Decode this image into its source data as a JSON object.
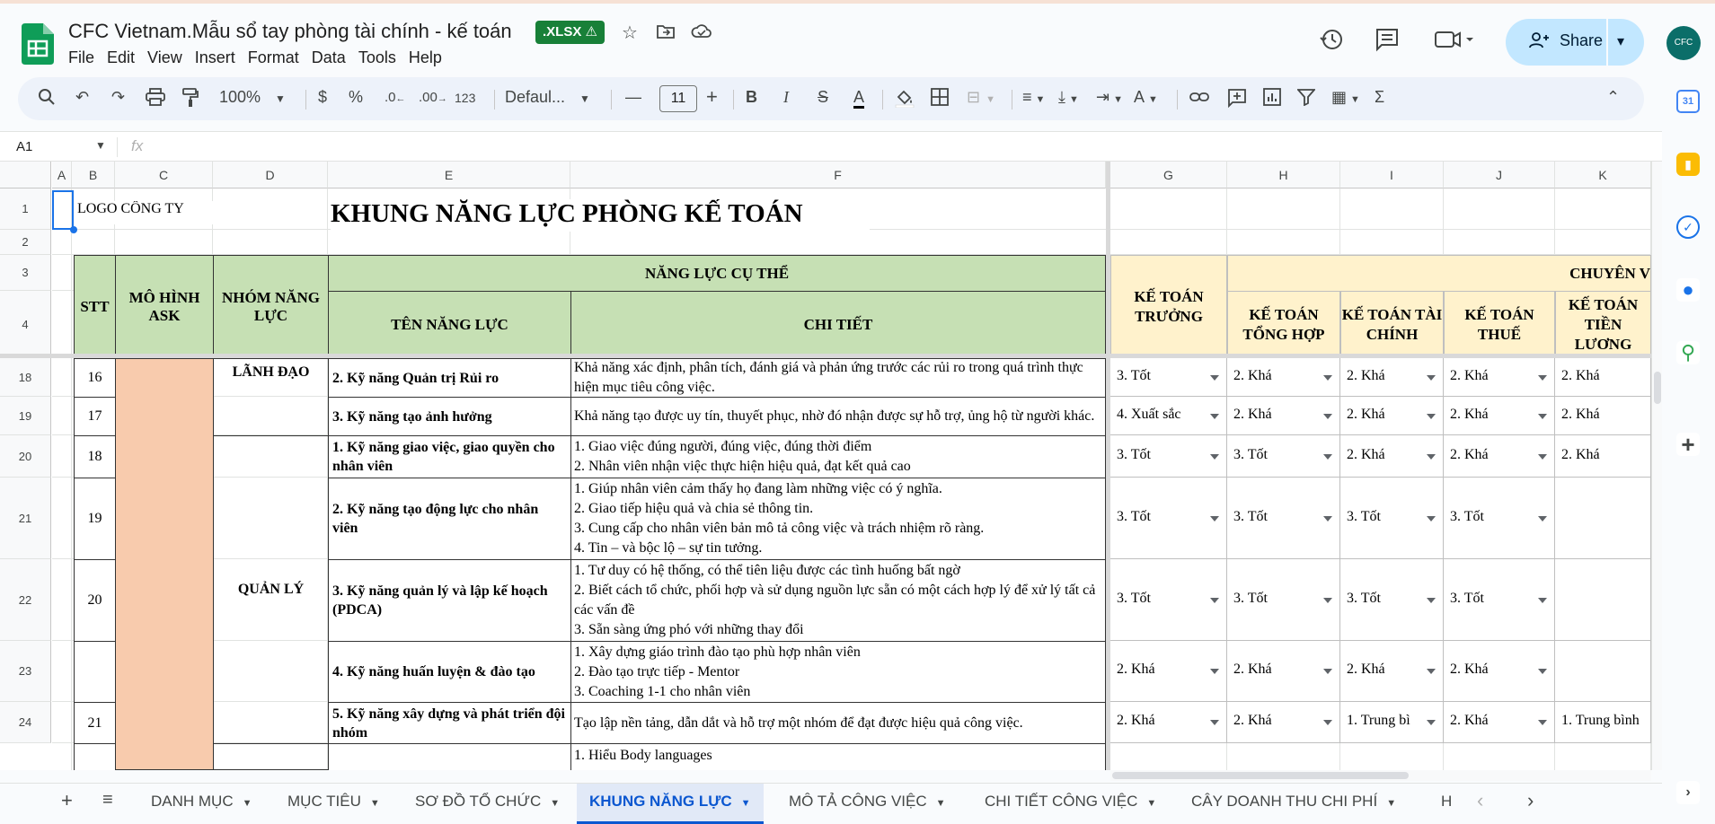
{
  "doc": {
    "title": "CFC Vietnam.Mẫu sổ tay phòng tài chính - kế toán",
    "badge": ".XLSX ⚠"
  },
  "menu": [
    "File",
    "Edit",
    "View",
    "Insert",
    "Format",
    "Data",
    "Tools",
    "Help"
  ],
  "share_label": "Share",
  "toolbar": {
    "zoom": "100%",
    "currency": "$",
    "percent": "%",
    "dec_decrease": ".0",
    "dec_increase": ".00",
    "number_format": "123",
    "font": "Defaul...",
    "font_size": "11",
    "bold": "B",
    "italic": "I",
    "strike": "S",
    "text_color": "A"
  },
  "formula_bar": {
    "cell_ref": "A1",
    "fx": "fx"
  },
  "columns": [
    "A",
    "B",
    "C",
    "D",
    "E",
    "F",
    "G",
    "H",
    "I",
    "J",
    "K"
  ],
  "rows": [
    "1",
    "2",
    "3",
    "4",
    "18",
    "19",
    "20",
    "21",
    "22",
    "23",
    "24"
  ],
  "sheet": {
    "logo": "LOGO CÔNG TY",
    "title": "KHUNG NĂNG LỰC PHÒNG KẾ TOÁN",
    "headers": {
      "stt": "STT",
      "ask": "MÔ HÌNH ASK",
      "group": "NHÓM NĂNG LỰC",
      "specific": "NĂNG LỰC CỤ THỂ",
      "name": "TÊN NĂNG LỰC",
      "detail": "CHI TIẾT",
      "chief": "KẾ TOÁN TRƯỞNG",
      "specialist": "CHUYÊN V",
      "general": "KẾ TOÁN TỔNG HỢP",
      "finance": "KẾ TOÁN TÀI CHÍNH",
      "tax": "KẾ TOÁN THUẾ",
      "salary": "KẾ TOÁN TIỀN LƯƠNG"
    },
    "groups": {
      "leadership": "LÃNH ĐẠO",
      "management": "QUẢN LÝ"
    },
    "rows": [
      {
        "stt": "16",
        "name": "2. Kỹ năng Quản trị Rủi ro",
        "detail": "Khả năng xác định, phân tích, đánh giá và phản ứng trước các rủi ro trong quá trình thực hiện mục tiêu công việc.",
        "g": "3. Tốt",
        "h": "2. Khá",
        "i": "2. Khá",
        "j": "2. Khá",
        "k": "2. Khá"
      },
      {
        "stt": "17",
        "name": "3. Kỹ năng tạo ảnh hưởng",
        "detail": "Khả năng tạo được uy tín, thuyết phục, nhờ đó nhận được sự hỗ trợ, ủng hộ từ người khác.",
        "g": "4. Xuất sắc",
        "h": "2. Khá",
        "i": "2. Khá",
        "j": "2. Khá",
        "k": "2. Khá"
      },
      {
        "stt": "18",
        "name": "1. Kỹ năng giao việc, giao quyền cho nhân viên",
        "detail": "1. Giao việc đúng người, đúng việc, đúng thời điểm\n2. Nhân viên nhận việc thực hiện hiệu quả, đạt kết quả cao",
        "g": "3. Tốt",
        "h": "3. Tốt",
        "i": "2. Khá",
        "j": "2. Khá",
        "k": "2. Khá"
      },
      {
        "stt": "19",
        "name": "2. Kỹ năng tạo động lực cho nhân viên",
        "detail": "1. Giúp nhân viên cảm thấy họ đang làm những việc có ý nghĩa.\n2. Giao tiếp hiệu quả và chia sẻ thông tin.\n3. Cung cấp cho nhân viên bản mô tả công việc và trách nhiệm rõ ràng.\n4. Tin – và bộc lộ – sự tin tưởng.",
        "g": "3. Tốt",
        "h": "3. Tốt",
        "i": "3. Tốt",
        "j": "3. Tốt",
        "k": ""
      },
      {
        "stt": "20",
        "name": "3. Kỹ năng quản lý và lập kế hoạch (PDCA)",
        "detail": "1. Tư duy có hệ thống, có thể tiên liệu được các tình huống bất ngờ\n2. Biết cách tổ chức, phối hợp và sử dụng nguồn lực sẵn có một cách hợp lý để xử lý tất cả các vấn đề\n3. Sẵn sàng ứng phó với những thay đổi",
        "g": "3. Tốt",
        "h": "3. Tốt",
        "i": "3. Tốt",
        "j": "3. Tốt",
        "k": ""
      },
      {
        "stt": "",
        "name": "4. Kỹ năng huấn luyện & đào tạo",
        "detail": "1. Xây dựng giáo trình đào tạo phù hợp nhân viên\n2. Đào tạo trực tiếp - Mentor\n3. Coaching 1-1 cho nhân viên",
        "g": "2. Khá",
        "h": "2. Khá",
        "i": "2. Khá",
        "j": "2. Khá",
        "k": ""
      },
      {
        "stt": "21",
        "name": "5. Kỹ năng xây dựng và phát triển đội nhóm",
        "detail": "Tạo lập nền tảng, dẫn dắt và hỗ trợ một nhóm để đạt được hiệu quả công việc.",
        "g": "2. Khá",
        "h": "2. Khá",
        "i": "1. Trung bì",
        "j": "2. Khá",
        "k": "1. Trung bình"
      }
    ],
    "partial_detail": "1. Hiểu Body languages"
  },
  "tabs": [
    "DANH MỤC",
    "MỤC TIÊU",
    "SƠ ĐỒ TỔ CHỨC",
    "KHUNG NĂNG LỰC",
    "MÔ TẢ CÔNG VIỆC",
    "CHI TIẾT CÔNG VIỆC",
    "CÂY DOANH THU CHI PHÍ",
    "H"
  ],
  "active_tab": "KHUNG NĂNG LỰC",
  "avatar_text": "CFC",
  "colors": {
    "green_header": "#c6e0b4",
    "yellow_header": "#fff2cc",
    "ask_fill": "#f8cbad",
    "accent": "#0b57d0"
  }
}
